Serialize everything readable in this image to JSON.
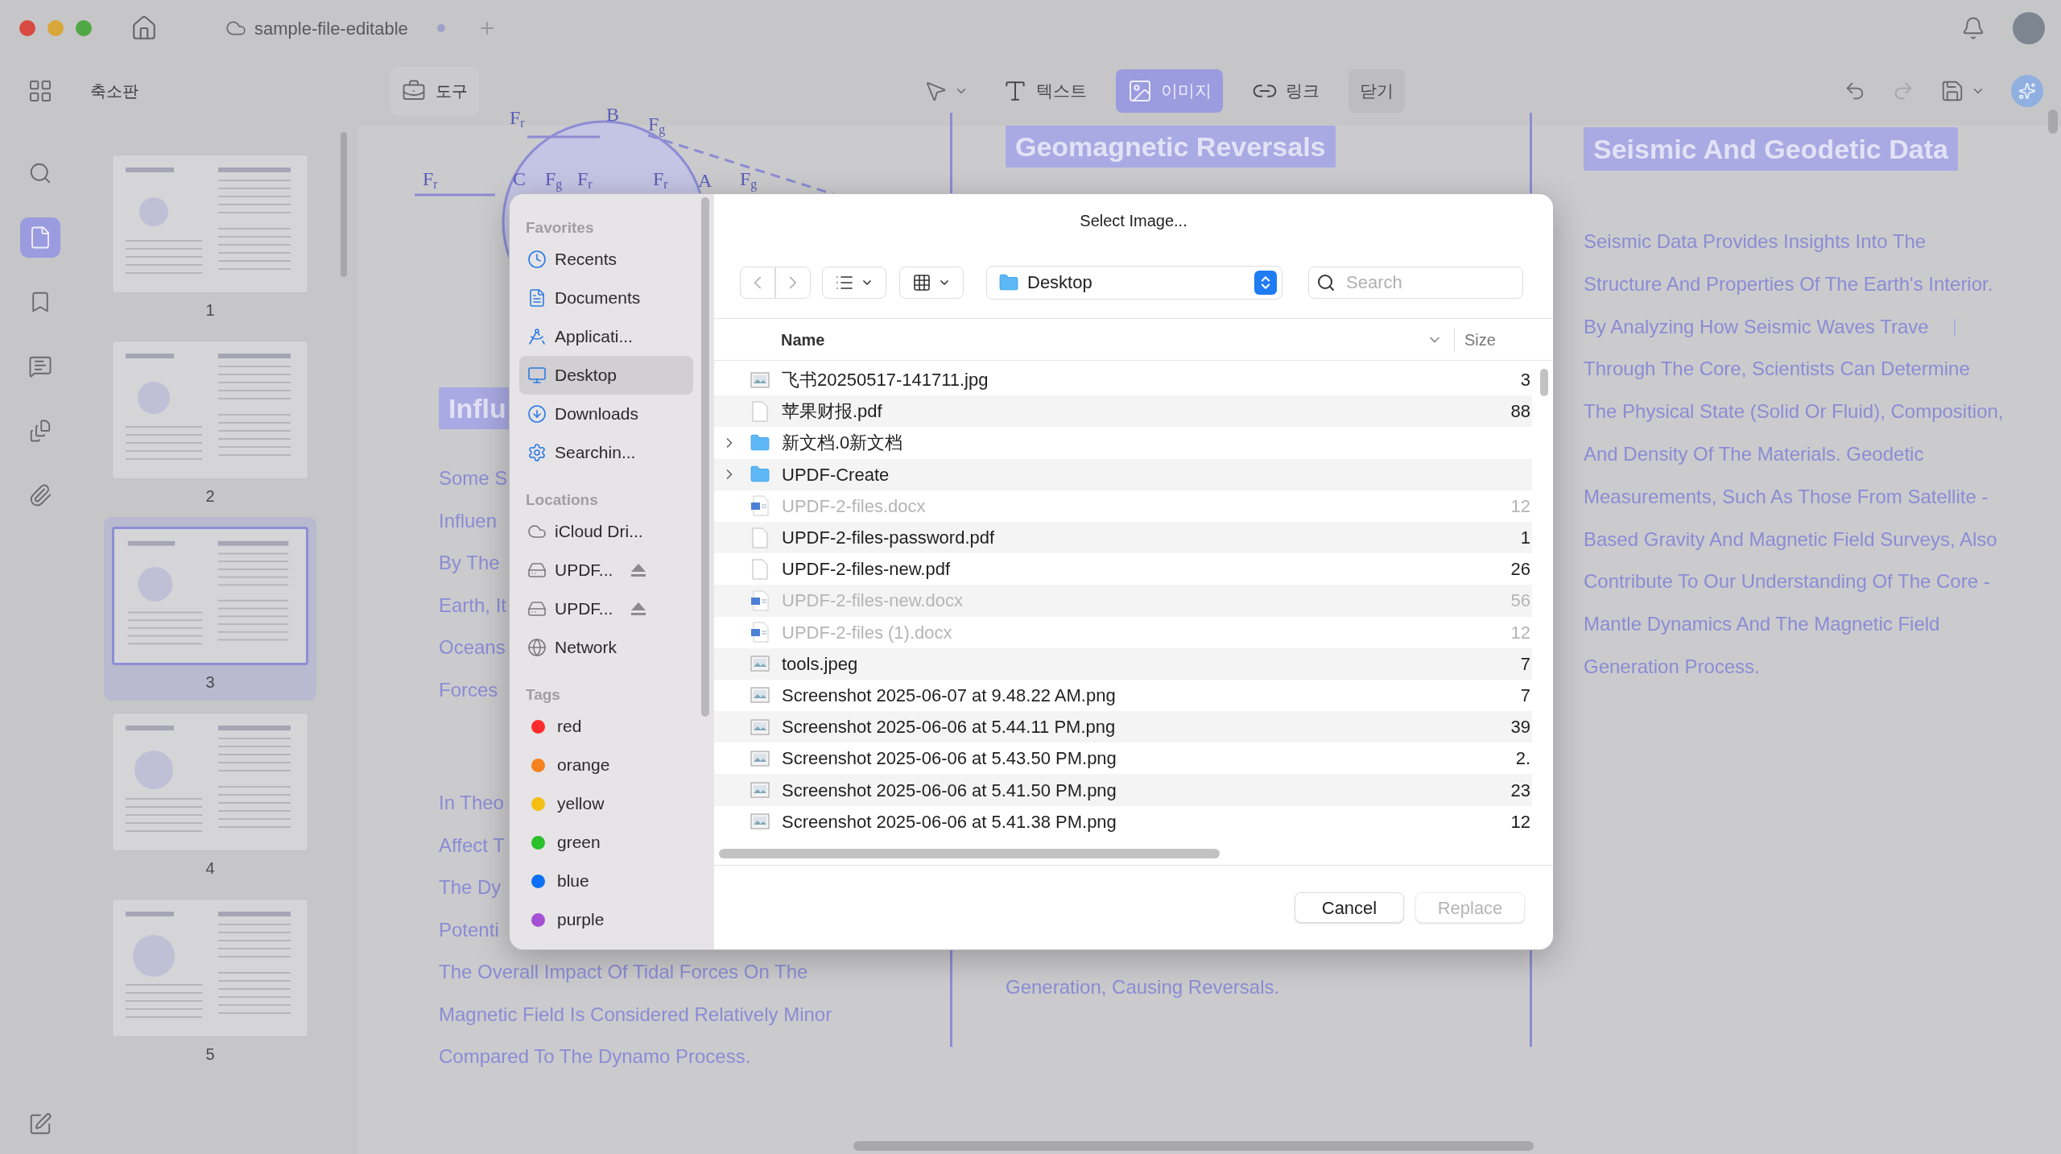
{
  "titlebar": {
    "tab": "sample-file-editable"
  },
  "toolbar": {
    "panel_title": "축소판",
    "tools_button": "도구",
    "modes": [
      {
        "kind": "text",
        "label": "텍스트",
        "selected": false
      },
      {
        "kind": "image",
        "label": "이미지",
        "selected": true
      },
      {
        "kind": "link",
        "label": "링크",
        "selected": false
      }
    ],
    "close_button": "닫기"
  },
  "rail": [
    {
      "kind": "search",
      "selected": false
    },
    {
      "kind": "pages",
      "selected": true
    },
    {
      "kind": "bookmark",
      "selected": false
    },
    {
      "kind": "comment",
      "selected": false
    },
    {
      "kind": "stack",
      "selected": false
    },
    {
      "kind": "attachment",
      "selected": false
    }
  ],
  "thumbnails": [
    {
      "number": "1",
      "selected": false
    },
    {
      "number": "2",
      "selected": false
    },
    {
      "number": "3",
      "selected": true
    },
    {
      "number": "4",
      "selected": false
    },
    {
      "number": "5",
      "selected": false
    }
  ],
  "document": {
    "diagram_labels": [
      {
        "text": "F",
        "sub": "r"
      },
      {
        "text": "B"
      },
      {
        "text": "F",
        "sub": "g"
      },
      {
        "text": "F",
        "sub": "r"
      },
      {
        "text": "C"
      },
      {
        "text": "F",
        "sub": "g"
      },
      {
        "text": "F",
        "sub": "r"
      },
      {
        "text": "F",
        "sub": "r"
      },
      {
        "text": "A"
      },
      {
        "text": "F",
        "sub": "g"
      }
    ],
    "left_column": {
      "heading": "Influ",
      "lines": [
        "Some S",
        "Influen",
        "By The",
        "Earth, It",
        "Oceans",
        "Forces"
      ],
      "lines_2": [
        "In Theo",
        "Affect T",
        "The Dy",
        "Potenti",
        "The Overall Impact Of Tidal Forces On The",
        "Magnetic Field Is Considered Relatively Minor",
        "Compared To The Dynamo Process."
      ]
    },
    "middle_column": {
      "heading": "Geomagnetic Reversals",
      "lines": [
        "Generation, Causing Reversals."
      ]
    },
    "right_column": {
      "heading": "Seismic And Geodetic Data",
      "lines": [
        "Seismic Data Provides Insights Into The",
        "Structure And Properties Of The Earth's Interior.",
        "By Analyzing How Seismic Waves Trave",
        "Through The Core, Scientists Can Determine",
        "The Physical State (Solid Or Fluid), Composition,",
        "And Density Of The Materials. Geodetic",
        "Measurements, Such As Those From Satellite -",
        "Based Gravity And Magnetic Field Surveys, Also",
        "Contribute To Our Understanding Of The Core -",
        "Mantle Dynamics And The Magnetic Field",
        "Generation Process."
      ]
    }
  },
  "dialog": {
    "title": "Select Image...",
    "location": "Desktop",
    "search": {
      "placeholder": "Search"
    },
    "sidebar": [
      {
        "title": "Favorites",
        "items": [
          {
            "kind": "recents",
            "label": "Recents",
            "selected": false
          },
          {
            "kind": "documents",
            "label": "Documents",
            "selected": false
          },
          {
            "kind": "applications",
            "label": "Applicati...",
            "selected": false
          },
          {
            "kind": "desktop",
            "label": "Desktop",
            "selected": true
          },
          {
            "kind": "downloads",
            "label": "Downloads",
            "selected": false
          },
          {
            "kind": "searching",
            "label": "Searchin...",
            "selected": false
          }
        ]
      },
      {
        "title": "Locations",
        "items": [
          {
            "kind": "cloud",
            "label": "iCloud Dri...",
            "selected": false,
            "ejectable": false
          },
          {
            "kind": "drive",
            "label": "UPDF...",
            "selected": false,
            "ejectable": true
          },
          {
            "kind": "drive",
            "label": "UPDF...",
            "selected": false,
            "ejectable": true
          },
          {
            "kind": "network",
            "label": "Network",
            "selected": false,
            "ejectable": false
          }
        ]
      },
      {
        "title": "Tags",
        "items": [
          {
            "kind": "tag",
            "label": "red",
            "color": "#fe2d2d",
            "selected": false
          },
          {
            "kind": "tag",
            "label": "orange",
            "color": "#f5821f",
            "selected": false
          },
          {
            "kind": "tag",
            "label": "yellow",
            "color": "#f4bf10",
            "selected": false
          },
          {
            "kind": "tag",
            "label": "green",
            "color": "#2ac02c",
            "selected": false
          },
          {
            "kind": "tag",
            "label": "blue",
            "color": "#0c70f4",
            "selected": false
          },
          {
            "kind": "tag",
            "label": "purple",
            "color": "#a54fd5",
            "selected": false
          }
        ]
      }
    ],
    "columns": [
      "Name",
      "Size"
    ],
    "files": [
      {
        "kind": "image",
        "name": "飞书20250517-141711.jpg",
        "size": "3",
        "disabled": false
      },
      {
        "kind": "pdf",
        "name": "苹果财报.pdf",
        "size": "88",
        "disabled": false
      },
      {
        "kind": "folder",
        "name": "新文档.0新文档",
        "disabled": false
      },
      {
        "kind": "folder",
        "name": "UPDF-Create",
        "disabled": false
      },
      {
        "kind": "docx",
        "name": "UPDF-2-files.docx",
        "size": "12",
        "disabled": true
      },
      {
        "kind": "pdf",
        "name": "UPDF-2-files-password.pdf",
        "size": "1",
        "disabled": false
      },
      {
        "kind": "pdf",
        "name": "UPDF-2-files-new.pdf",
        "size": "26",
        "disabled": false
      },
      {
        "kind": "docx",
        "name": "UPDF-2-files-new.docx",
        "size": "56",
        "disabled": true
      },
      {
        "kind": "docx",
        "name": "UPDF-2-files (1).docx",
        "size": "12",
        "disabled": true
      },
      {
        "kind": "image",
        "name": "tools.jpeg",
        "size": "7",
        "disabled": false
      },
      {
        "kind": "image",
        "name": "Screenshot 2025-06-07 at 9.48.22 AM.png",
        "size": "7",
        "disabled": false
      },
      {
        "kind": "image",
        "name": "Screenshot 2025-06-06 at 5.44.11 PM.png",
        "size": "39",
        "disabled": false
      },
      {
        "kind": "image",
        "name": "Screenshot 2025-06-06 at 5.43.50 PM.png",
        "size": "2.",
        "disabled": false
      },
      {
        "kind": "image",
        "name": "Screenshot 2025-06-06 at 5.41.50 PM.png",
        "size": "23",
        "disabled": false
      },
      {
        "kind": "image",
        "name": "Screenshot 2025-06-06 at 5.41.38 PM.png",
        "size": "12",
        "disabled": false
      }
    ],
    "buttons": [
      {
        "label": "Cancel",
        "disabled": false
      },
      {
        "label": "Replace",
        "disabled": true
      }
    ]
  }
}
